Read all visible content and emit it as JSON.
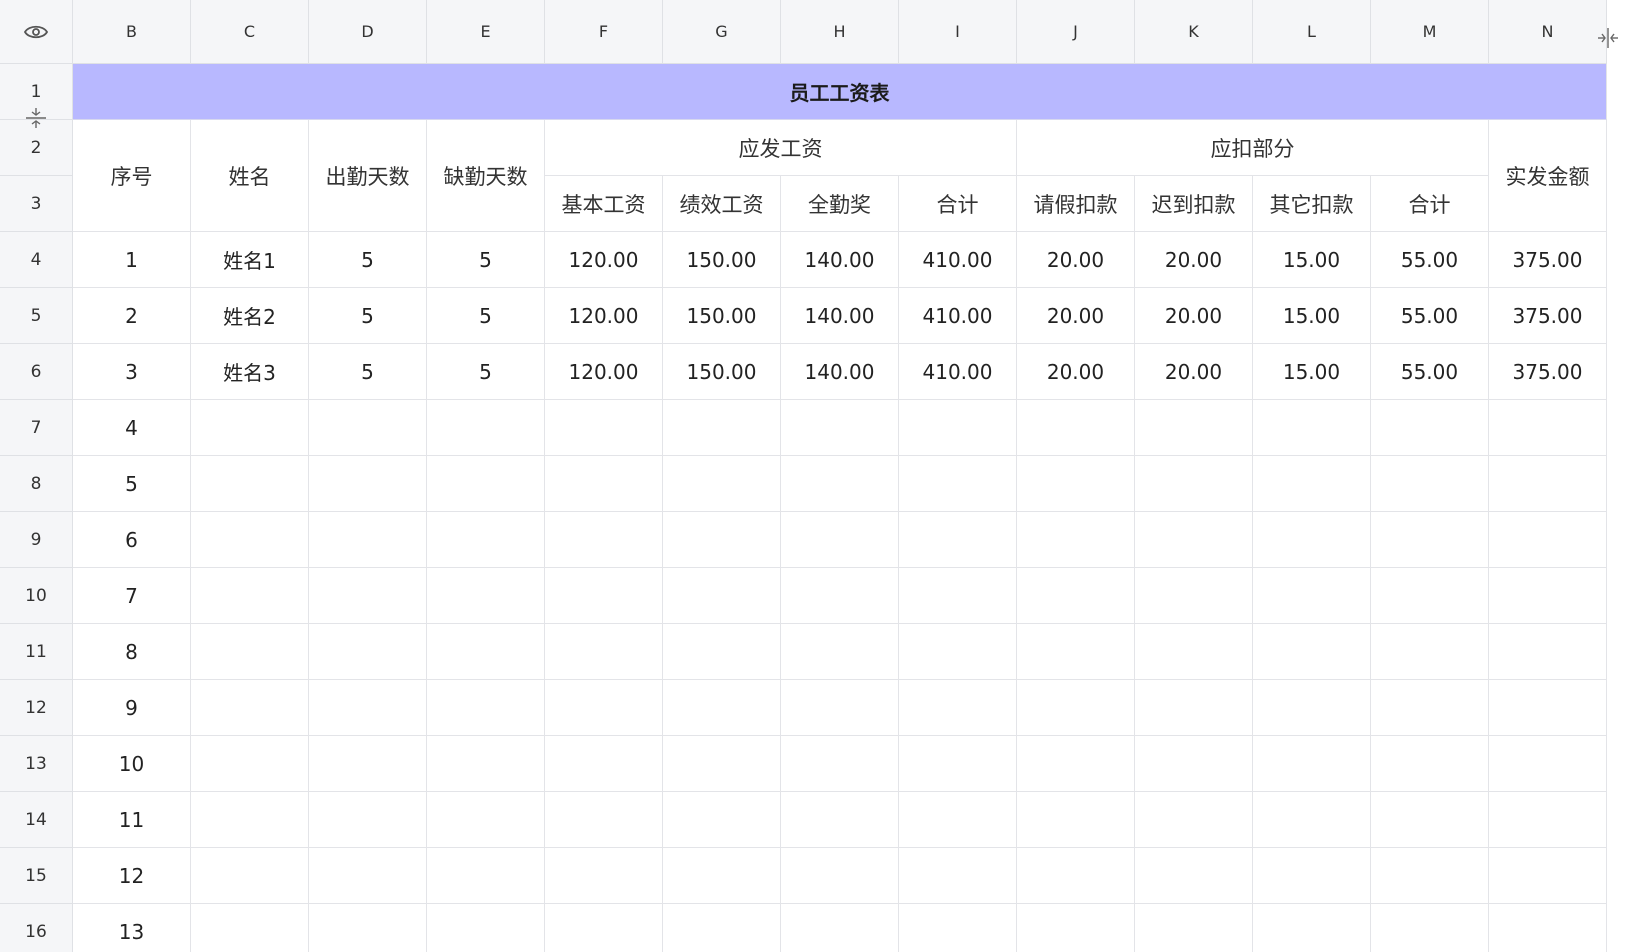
{
  "columns": [
    "B",
    "C",
    "D",
    "E",
    "F",
    "G",
    "H",
    "I",
    "J",
    "K",
    "L",
    "M",
    "N"
  ],
  "rows": [
    "1",
    "2",
    "3",
    "4",
    "5",
    "6",
    "7",
    "8",
    "9",
    "10",
    "11",
    "12",
    "13",
    "14",
    "15",
    "16"
  ],
  "title": "员工工资表",
  "headers": {
    "seq": "序号",
    "name": "姓名",
    "attendance": "出勤天数",
    "absence": "缺勤天数",
    "payable": "应发工资",
    "base": "基本工资",
    "performance": "绩效工资",
    "full_attendance": "全勤奖",
    "payable_total": "合计",
    "deductions": "应扣部分",
    "leave": "请假扣款",
    "late": "迟到扣款",
    "other": "其它扣款",
    "deduction_total": "合计",
    "net": "实发金额"
  },
  "data_rows": [
    {
      "seq": "1",
      "name": "姓名1",
      "attendance": "5",
      "absence": "5",
      "base": "120.00",
      "performance": "150.00",
      "full": "140.00",
      "ptotal": "410.00",
      "leave": "20.00",
      "late": "20.00",
      "other": "15.00",
      "dtotal": "55.00",
      "net": "375.00"
    },
    {
      "seq": "2",
      "name": "姓名2",
      "attendance": "5",
      "absence": "5",
      "base": "120.00",
      "performance": "150.00",
      "full": "140.00",
      "ptotal": "410.00",
      "leave": "20.00",
      "late": "20.00",
      "other": "15.00",
      "dtotal": "55.00",
      "net": "375.00"
    },
    {
      "seq": "3",
      "name": "姓名3",
      "attendance": "5",
      "absence": "5",
      "base": "120.00",
      "performance": "150.00",
      "full": "140.00",
      "ptotal": "410.00",
      "leave": "20.00",
      "late": "20.00",
      "other": "15.00",
      "dtotal": "55.00",
      "net": "375.00"
    }
  ],
  "empty_seq": [
    "4",
    "5",
    "6",
    "7",
    "8",
    "9",
    "10",
    "11",
    "12",
    "13"
  ],
  "colors": {
    "title_fill": "#b8b8ff",
    "header_fill": "#f5f6f8",
    "grid_line": "#e3e4e8"
  },
  "icons": {
    "corner": "eye-icon",
    "column_resize": "column-resize-icon",
    "row_resize": "row-resize-icon"
  }
}
